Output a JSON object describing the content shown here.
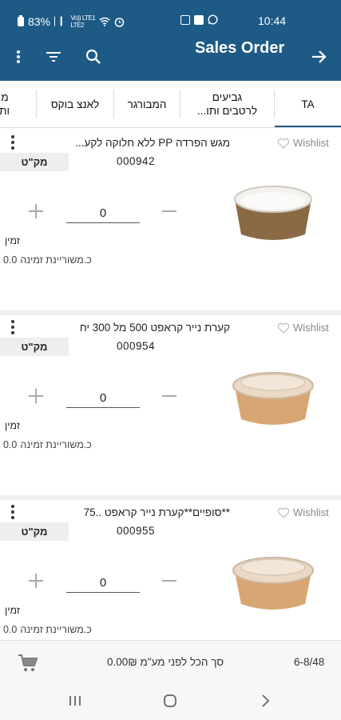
{
  "status_bar": {
    "battery": "83%",
    "time": "10:44",
    "signal_top": "Vo)) LTE1",
    "signal_bottom": "LTE2"
  },
  "header": {
    "title": "Sales Order"
  },
  "tabs": [
    {
      "label": "TA"
    },
    {
      "label": "גביעים לרטבים ותו..."
    },
    {
      "label": "המבורגר"
    },
    {
      "label": "לאנצ בוקס"
    },
    {
      "label": "מ ות"
    }
  ],
  "products": [
    {
      "name": "מגש הפרדה PP ללא חלוקה לקע...",
      "wishlist_label": "Wishlist",
      "sku_label": "מק\"ט",
      "sku": "000942",
      "quantity": "0",
      "availability_label": "זמין",
      "orders_label": "כ.משוריינת זמינה",
      "orders_value": "0.0",
      "image": "brown-paper-bowl-with-white-lid"
    },
    {
      "name": "קערת נייר קראפט 500 מל 300 יח",
      "wishlist_label": "Wishlist",
      "sku_label": "מק\"ט",
      "sku": "000954",
      "quantity": "0",
      "availability_label": "זמין",
      "orders_label": "כ.משוריינת זמינה",
      "orders_value": "0.0",
      "image": "kraft-bowl-with-clear-lid"
    },
    {
      "name": "**סופיים**קערת נייר קראפט ..75",
      "wishlist_label": "Wishlist",
      "sku_label": "מק\"ט",
      "sku": "000955",
      "quantity": "0",
      "availability_label": "זמין",
      "orders_label": "כ.משוריינת זמינה",
      "orders_value": "0.0",
      "image": "kraft-bowl-with-clear-lid"
    }
  ],
  "footer": {
    "total_text": "סך הכל לפני מע\"מ  0.00₪",
    "page_count": "6-8/48"
  },
  "colors": {
    "header_bg": "#1d5a86",
    "tab_active_underline": "#1d5a86"
  }
}
